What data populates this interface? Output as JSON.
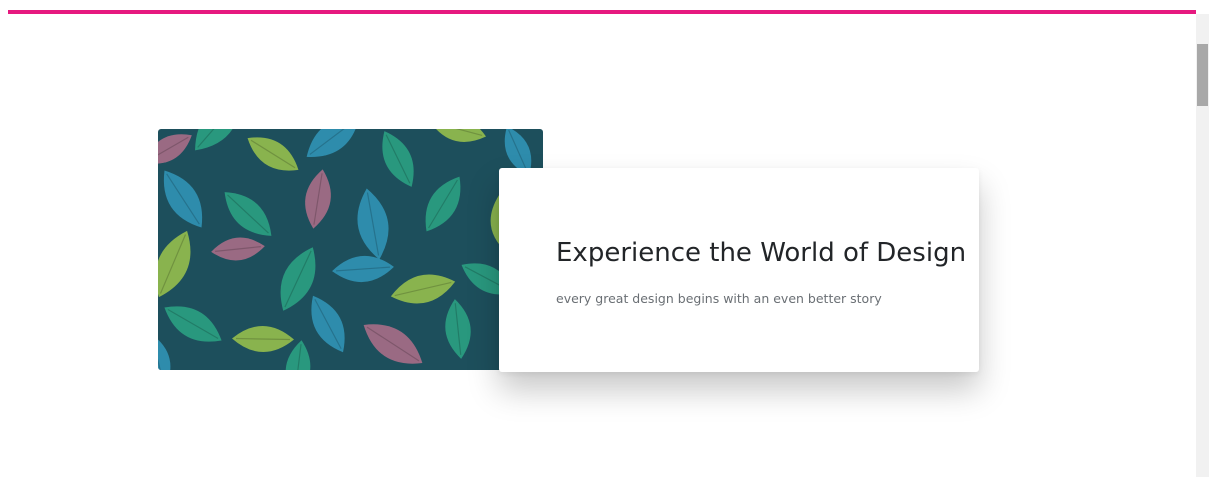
{
  "theme": {
    "accent_color": "#e6197f",
    "leaf_colors": [
      "#8fb84d",
      "#2a9c7f",
      "#2f8fb0",
      "#a16b85",
      "#1f5f6b"
    ]
  },
  "hero": {
    "image_icon": "leaves-image",
    "title": "Experience the World of Design",
    "subtitle": "every great design begins with an even better story"
  }
}
